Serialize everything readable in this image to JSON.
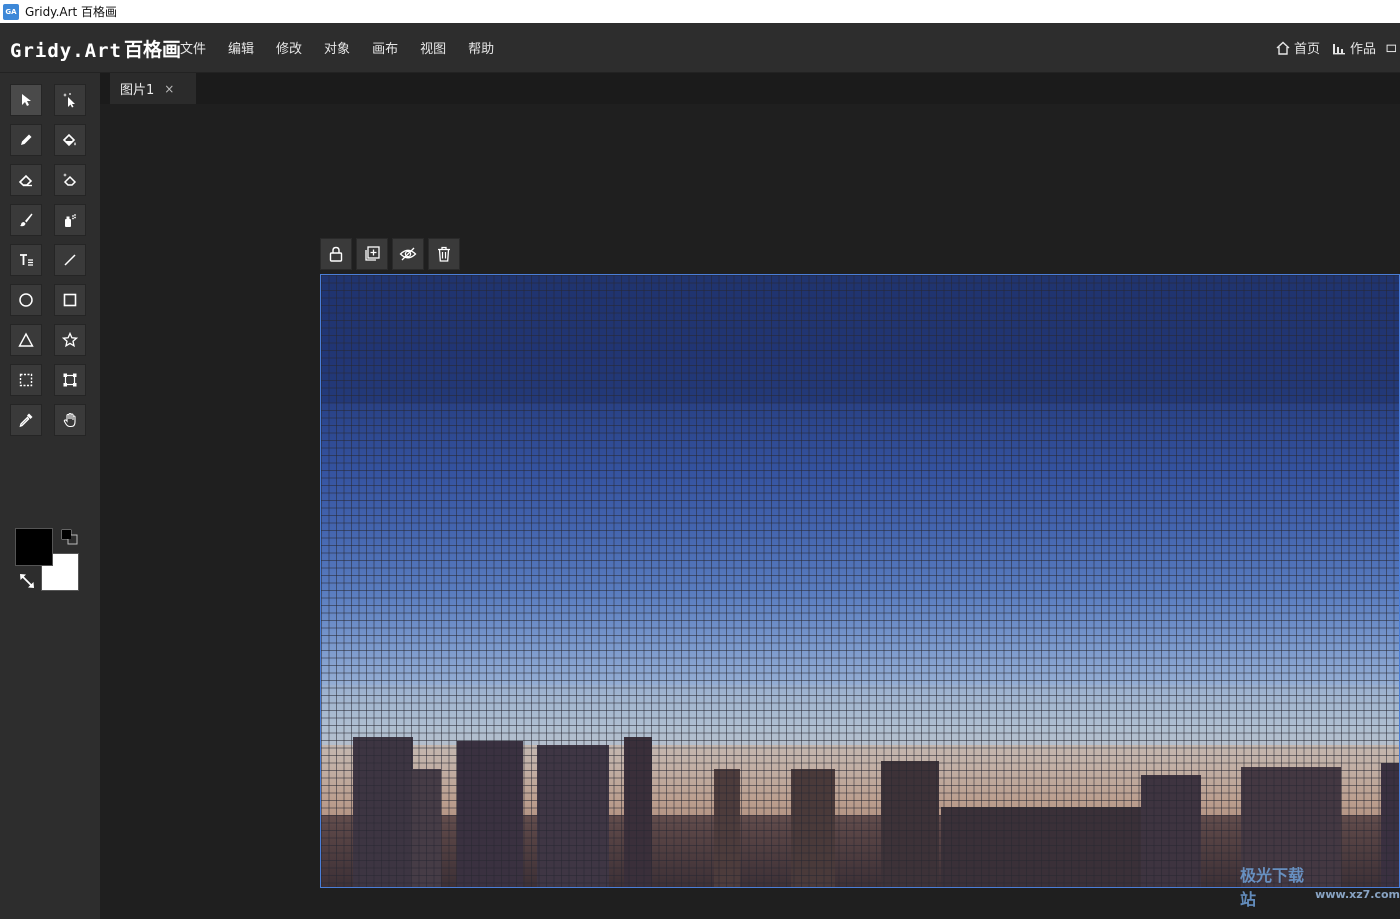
{
  "window": {
    "title": "Gridy.Art 百格画",
    "icon_text": "GA"
  },
  "logo": {
    "en": "Gridy.Art",
    "zh": "百格画"
  },
  "menu": [
    "文件",
    "编辑",
    "修改",
    "对象",
    "画布",
    "视图",
    "帮助"
  ],
  "right_nav": {
    "home": "首页",
    "works": "作品"
  },
  "tabs": [
    {
      "label": "图片1",
      "close": "×"
    }
  ],
  "tools": [
    "select-arrow-icon",
    "magic-select-icon",
    "pencil-icon",
    "paint-bucket-icon",
    "eraser-icon",
    "magic-eraser-icon",
    "brush-icon",
    "spray-icon",
    "text-icon",
    "line-icon",
    "circle-icon",
    "rectangle-icon",
    "triangle-icon",
    "star-icon",
    "marquee-select-icon",
    "transform-icon",
    "eyedropper-icon",
    "hand-icon"
  ],
  "colors": {
    "foreground": "#000000",
    "background": "#ffffff",
    "canvas_border": "#4a7ed8",
    "accent": "#3d88d8"
  },
  "layer_tools": [
    "lock-icon",
    "add-layer-icon",
    "hide-eye-icon",
    "delete-icon"
  ],
  "watermark": {
    "text": "极光下载站",
    "url": "www.xz7.com"
  }
}
